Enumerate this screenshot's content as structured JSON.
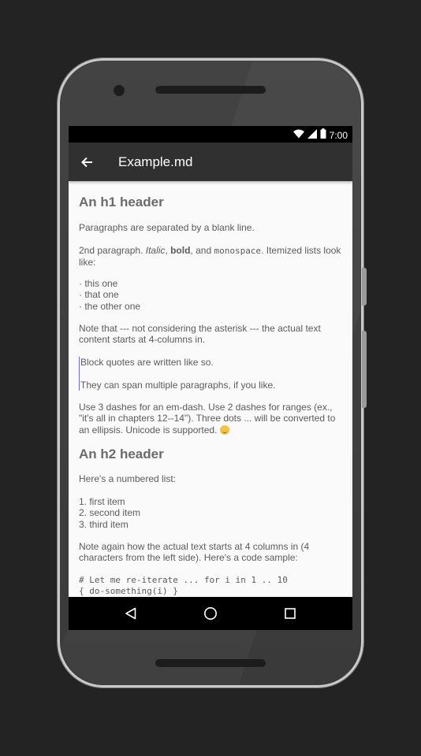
{
  "status": {
    "time": "7:00",
    "icons": [
      "wifi-icon",
      "signal-icon",
      "battery-icon"
    ]
  },
  "appbar": {
    "title": "Example.md",
    "back_icon": "arrow-back-icon"
  },
  "doc": {
    "h1": "An h1 header",
    "p1": "Paragraphs are separated by a blank line.",
    "p2_pre": "2nd paragraph. ",
    "p2_italic": "Italic",
    "p2_sep1": ", ",
    "p2_bold": "bold",
    "p2_sep2": ", and ",
    "p2_mono": "monospace",
    "p2_post": ". Itemized lists look like:",
    "bullets": [
      "· this one",
      "· that one",
      "· the other one"
    ],
    "p3": "Note that --- not considering the asterisk --- the actual text content starts at 4-columns in.",
    "quote1": "Block quotes are written like so.",
    "quote2": "They can span multiple paragraphs, if you like.",
    "p4": "Use 3 dashes for an em-dash. Use 2 dashes for ranges (ex., \"it's all in chapters 12--14\"). Three dots ... will be converted to an ellipsis. Unicode is supported.",
    "h2": "An h2 header",
    "p5": "Here's a numbered list:",
    "numbered": [
      "1. first item",
      "2. second item",
      "3. third item"
    ],
    "p6": "Note again how the actual text starts at 4 columns in (4 characters from the left side). Here's a code sample:",
    "code": [
      "# Let me re-iterate ... for i in 1 .. 10",
      "{ do-something(i) }"
    ]
  },
  "colors": {
    "appbar": "#303030",
    "statusbar": "#000000",
    "content_bg": "#fafafa",
    "text": "#5b5b5b",
    "quote_bar": "#6a6ad0"
  },
  "navbar": {
    "icons": [
      "back-triangle-icon",
      "home-circle-icon",
      "recents-square-icon"
    ]
  }
}
